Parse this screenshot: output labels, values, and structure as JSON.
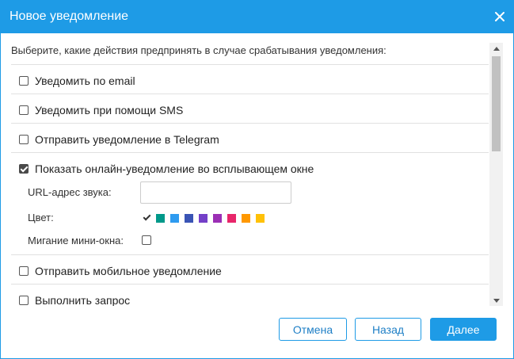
{
  "dialog": {
    "title": "Новое уведомление",
    "close_icon": "close-icon",
    "intro": "Выберите, какие действия предпринять в случае срабатывания уведомления:"
  },
  "options": [
    {
      "label": "Уведомить по email",
      "checked": false
    },
    {
      "label": "Уведомить при помощи SMS",
      "checked": false
    },
    {
      "label": "Отправить уведомление в Telegram",
      "checked": false
    },
    {
      "label": "Показать онлайн-уведомление во всплывающем окне",
      "checked": true
    },
    {
      "label": "Отправить мобильное уведомление",
      "checked": false
    },
    {
      "label": "Выполнить запрос",
      "checked": false
    }
  ],
  "popup": {
    "sound_url_label": "URL-адрес звука:",
    "sound_url_value": "",
    "color_label": "Цвет:",
    "colors": [
      "#ffffff",
      "#00998a",
      "#2e9bf0",
      "#3a54b5",
      "#7440c8",
      "#9b2fb5",
      "#e8266a",
      "#ff9800",
      "#ffc107"
    ],
    "selected_color": "#ffffff",
    "blink_label": "Мигание мини-окна:",
    "blink_checked": false
  },
  "footer": {
    "cancel_label": "Отмена",
    "back_label": "Назад",
    "next_label": "Далее"
  },
  "theme": {
    "accent": "#1e9be6"
  }
}
